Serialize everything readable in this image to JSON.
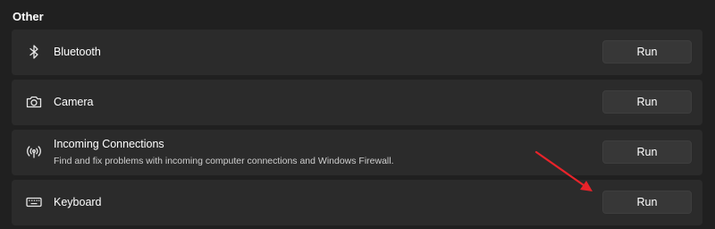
{
  "section": {
    "title": "Other"
  },
  "items": [
    {
      "label": "Bluetooth",
      "icon": "bluetooth-icon",
      "button_label": "Run"
    },
    {
      "label": "Camera",
      "icon": "camera-icon",
      "button_label": "Run"
    },
    {
      "label": "Incoming Connections",
      "description": "Find and fix problems with incoming computer connections and Windows Firewall.",
      "icon": "wireless-antenna-icon",
      "button_label": "Run"
    },
    {
      "label": "Keyboard",
      "icon": "keyboard-icon",
      "button_label": "Run"
    }
  ],
  "colors": {
    "background": "#202020",
    "card": "#2b2b2b",
    "button": "#373737",
    "annotation_arrow": "#e8232a"
  }
}
